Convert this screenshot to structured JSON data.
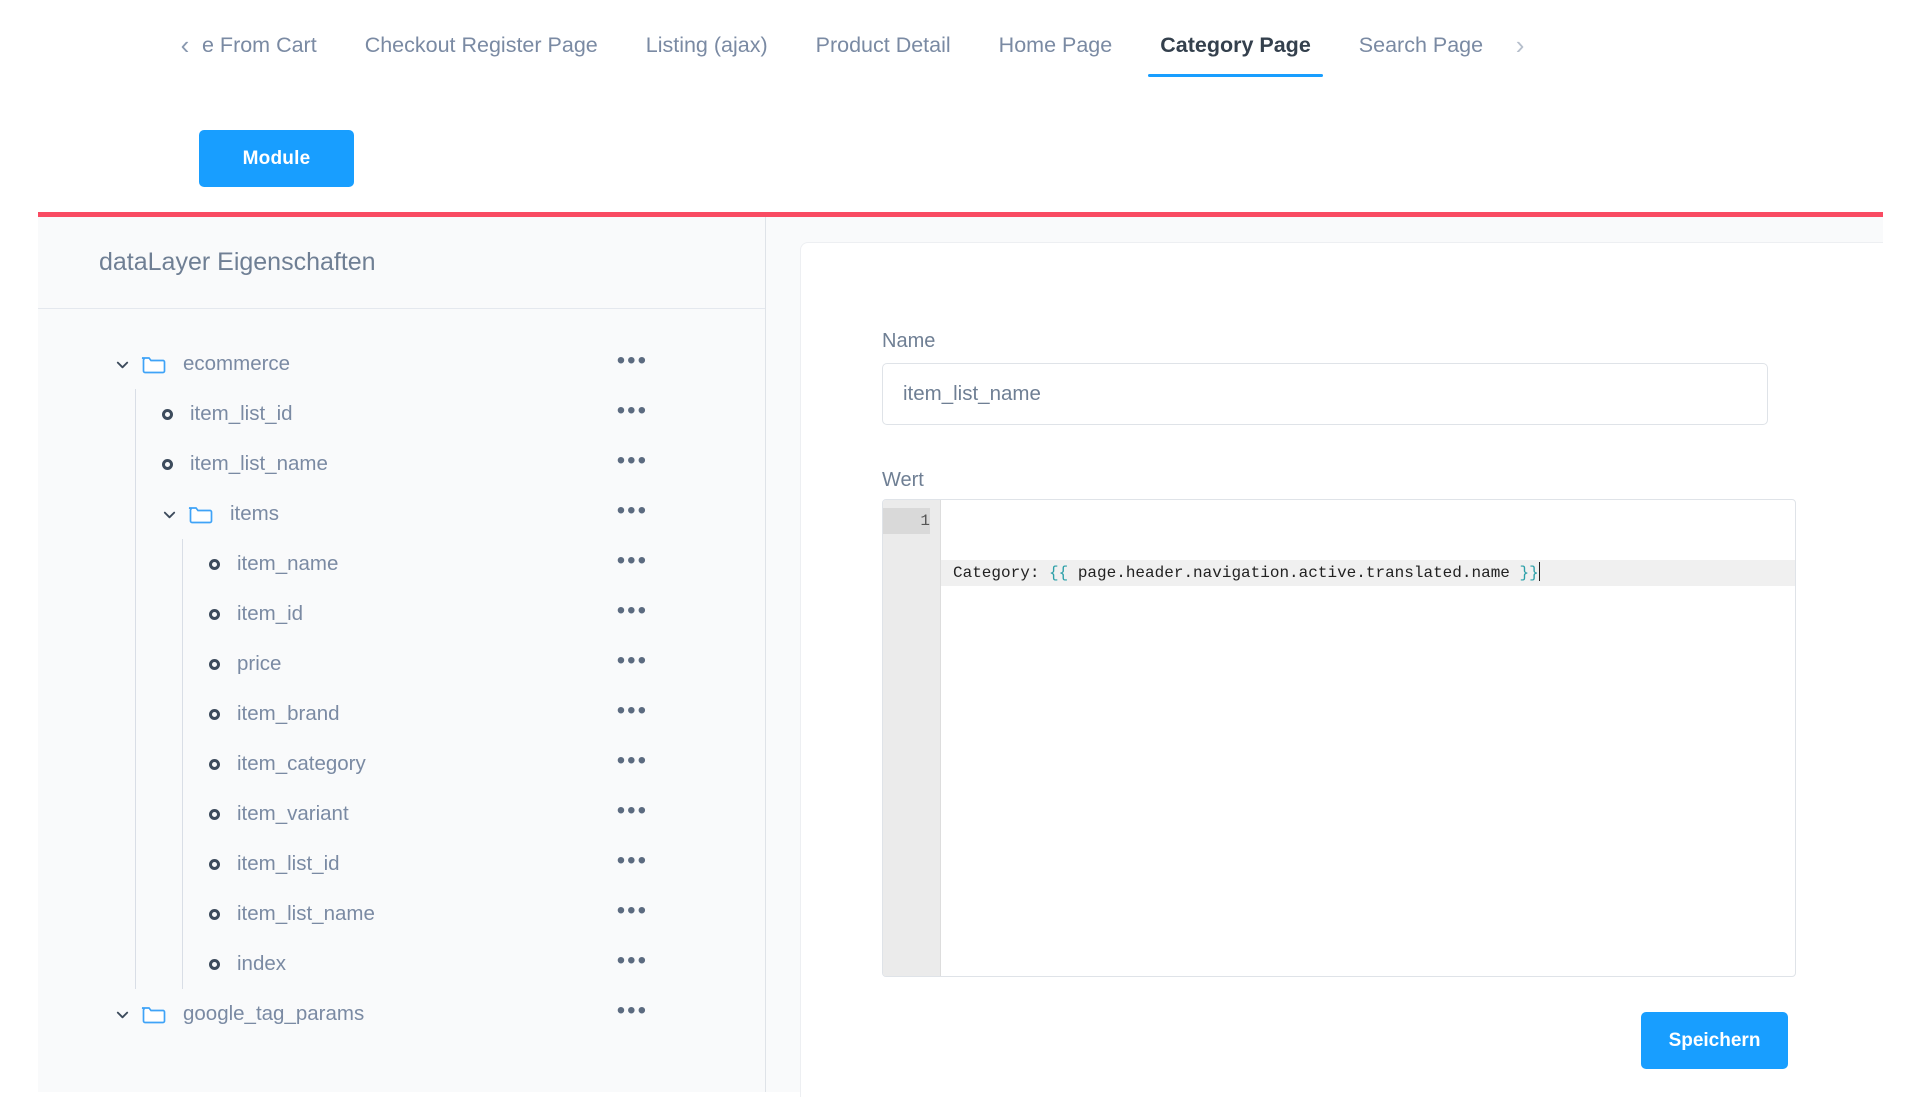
{
  "tabbar": {
    "prev_arrow": "‹",
    "next_arrow": "›",
    "tabs": [
      {
        "label": "e From Cart",
        "active": false,
        "clipped": true
      },
      {
        "label": "Checkout Register Page",
        "active": false
      },
      {
        "label": "Listing (ajax)",
        "active": false
      },
      {
        "label": "Product Detail",
        "active": false
      },
      {
        "label": "Home Page",
        "active": false
      },
      {
        "label": "Category Page",
        "active": true
      },
      {
        "label": "Search Page",
        "active": false
      }
    ]
  },
  "toolbar": {
    "module_label": "Module"
  },
  "sidebar": {
    "title": "dataLayer Eigenschaften",
    "row_menu": "•••",
    "chevron_open": "⌄",
    "items": [
      {
        "label": "ecommerce",
        "type": "folder",
        "level": 0,
        "expanded": true
      },
      {
        "label": "item_list_id",
        "type": "leaf",
        "level": 1
      },
      {
        "label": "item_list_name",
        "type": "leaf",
        "level": 1
      },
      {
        "label": "items",
        "type": "folder",
        "level": 1,
        "expanded": true
      },
      {
        "label": "item_name",
        "type": "leaf",
        "level": 2
      },
      {
        "label": "item_id",
        "type": "leaf",
        "level": 2
      },
      {
        "label": "price",
        "type": "leaf",
        "level": 2
      },
      {
        "label": "item_brand",
        "type": "leaf",
        "level": 2
      },
      {
        "label": "item_category",
        "type": "leaf",
        "level": 2
      },
      {
        "label": "item_variant",
        "type": "leaf",
        "level": 2
      },
      {
        "label": "item_list_id",
        "type": "leaf",
        "level": 2
      },
      {
        "label": "item_list_name",
        "type": "leaf",
        "level": 2
      },
      {
        "label": "index",
        "type": "leaf",
        "level": 2
      },
      {
        "label": "google_tag_params",
        "type": "folder",
        "level": 0,
        "expanded": true
      }
    ]
  },
  "form": {
    "name_label": "Name",
    "name_value": "item_list_name",
    "name_placeholder": "Name",
    "wert_label": "Wert",
    "editor": {
      "line_number": "1",
      "code_prefix": "Category: ",
      "code_open": "{{",
      "code_expr": " page.header.navigation.active.translated.name ",
      "code_close": "}}"
    },
    "save_label": "Speichern"
  },
  "colors": {
    "accent": "#189eff",
    "top_border": "#f94b62",
    "folder_icon": "#3fa3f7",
    "text_muted": "#7a8aa3",
    "twig_delimiter": "#2b9fa8"
  }
}
